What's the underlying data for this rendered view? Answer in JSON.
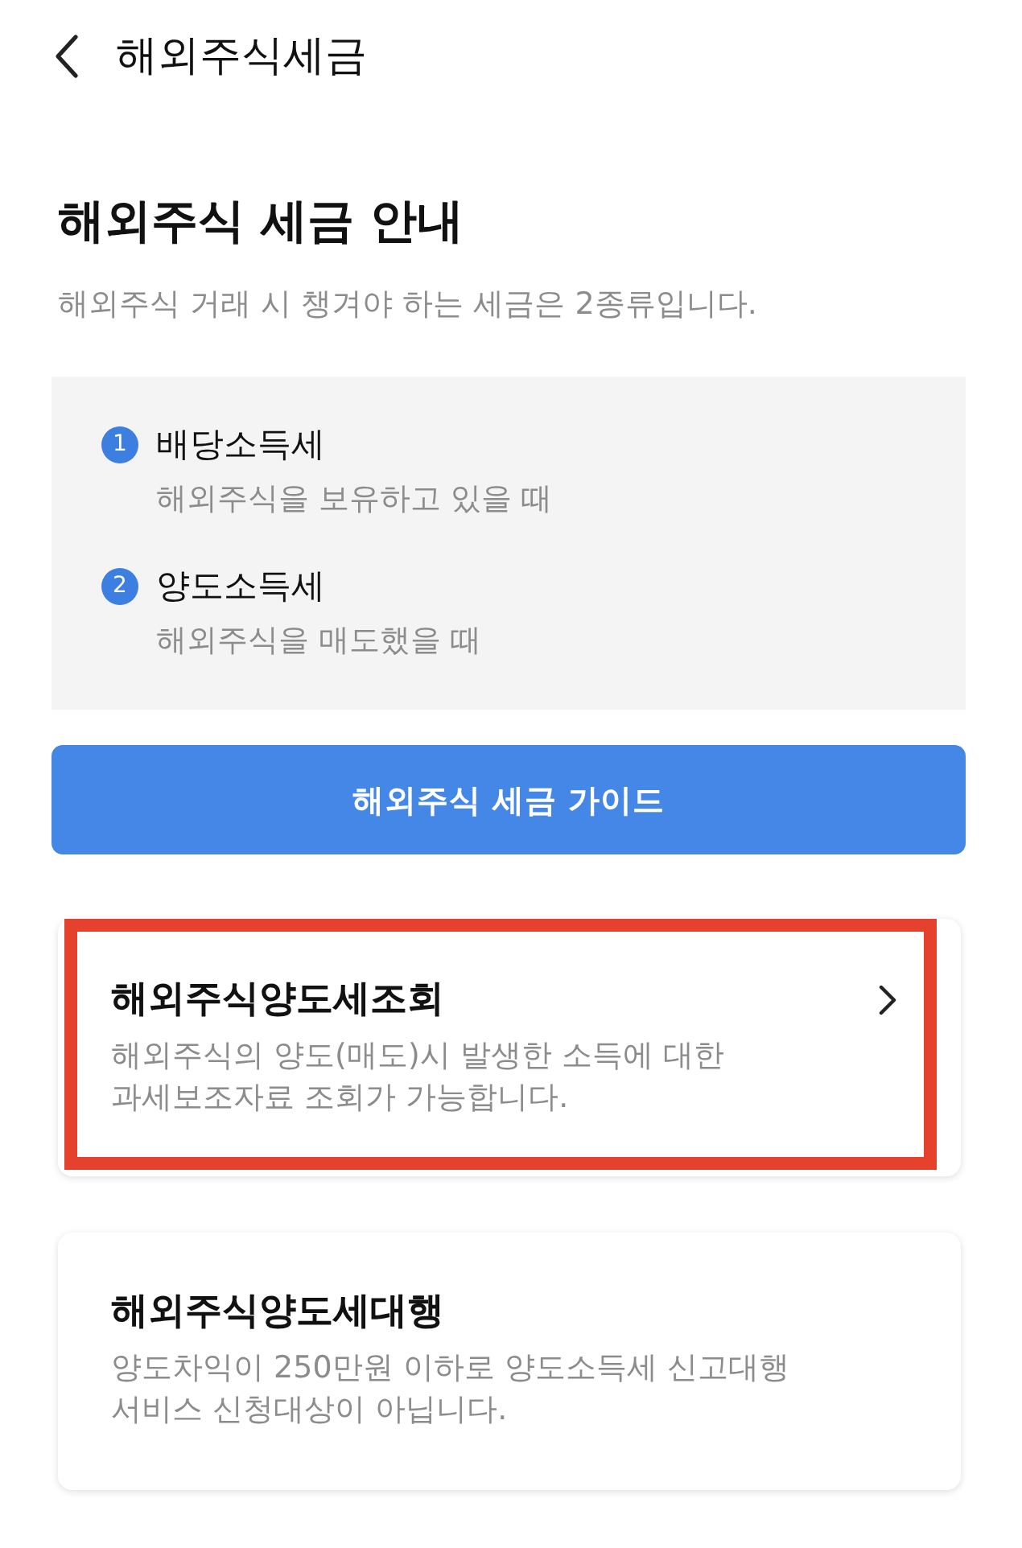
{
  "header": {
    "title": "해외주식세금"
  },
  "intro": {
    "heading": "해외주식 세금 안내",
    "subtitle": "해외주식 거래 시 챙겨야 하는 세금은 2종류입니다."
  },
  "tax_types": [
    {
      "number": "1",
      "name": "배당소득세",
      "description": "해외주식을 보유하고 있을 때"
    },
    {
      "number": "2",
      "name": "양도소득세",
      "description": "해외주식을 매도했을 때"
    }
  ],
  "guide_button": {
    "label": "해외주식 세금 가이드"
  },
  "cards": [
    {
      "title": "해외주식양도세조회",
      "description": "해외주식의 양도(매도)시 발생한 소득에 대한\n과세보조자료 조회가 가능합니다.",
      "has_arrow": true,
      "highlighted": true
    },
    {
      "title": "해외주식양도세대행",
      "description": "양도차익이 250만원 이하로 양도소득세 신고대행\n서비스 신청대상이 아닙니다.",
      "has_arrow": false,
      "highlighted": false
    }
  ]
}
